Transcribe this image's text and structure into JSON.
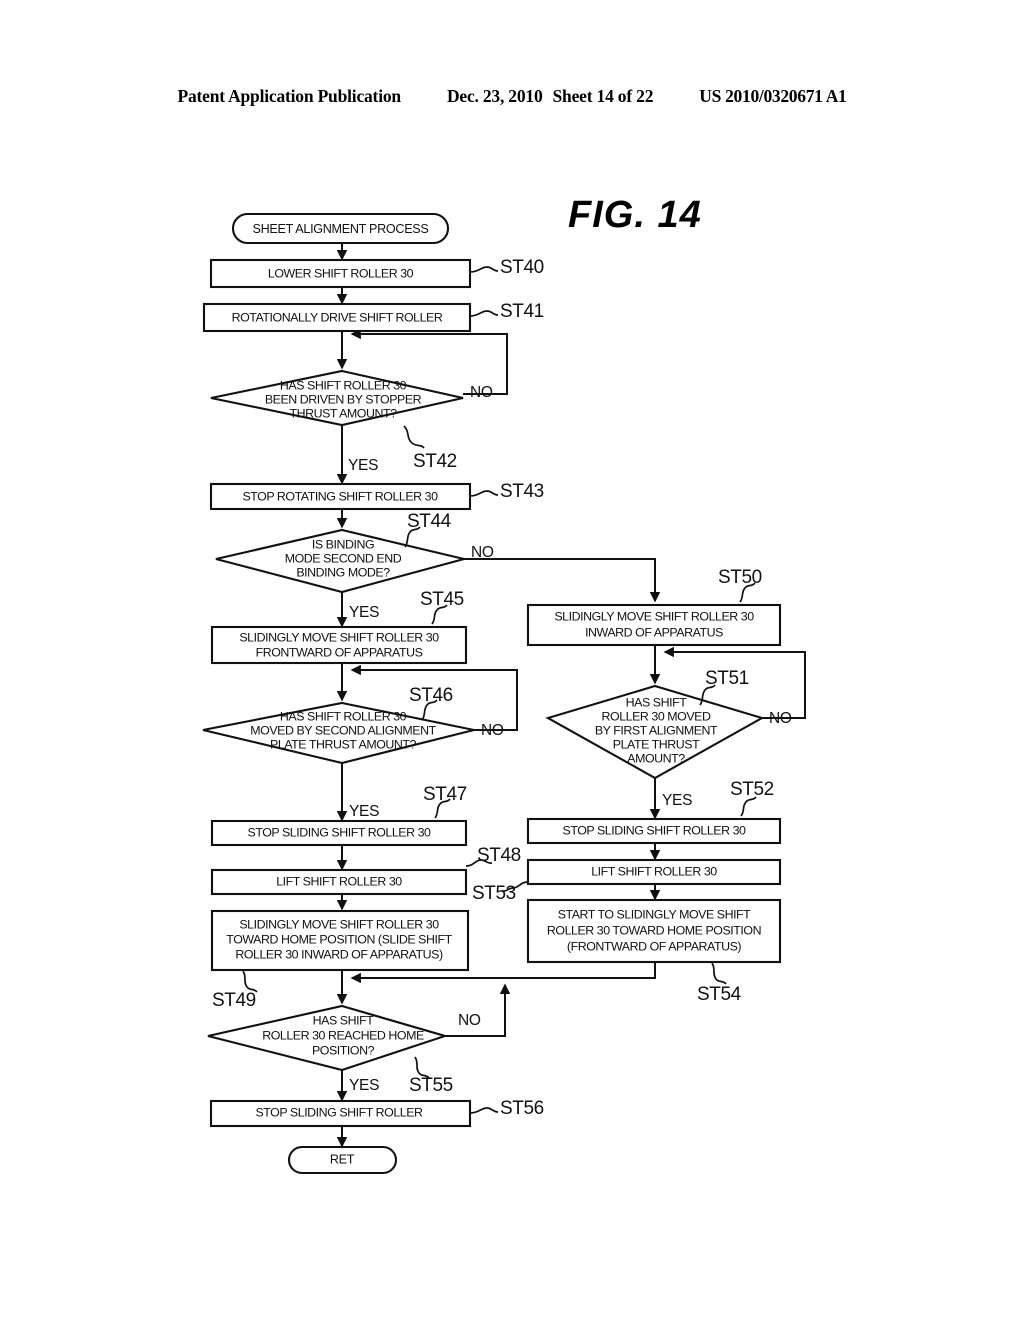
{
  "header": {
    "publication": "Patent Application Publication",
    "date": "Dec. 23, 2010",
    "sheet": "Sheet 14 of 22",
    "patent_number": "US 2010/0320671 A1"
  },
  "figure": {
    "title": "FIG.  14"
  },
  "branch_labels": {
    "yes": "YES",
    "no": "NO"
  },
  "nodes": {
    "start": {
      "label": "SHEET ALIGNMENT PROCESS",
      "shape": "terminator"
    },
    "st40": {
      "step": "ST40",
      "shape": "process",
      "lines": [
        "LOWER SHIFT ROLLER 30"
      ]
    },
    "st41": {
      "step": "ST41",
      "shape": "process",
      "lines": [
        "ROTATIONALLY DRIVE SHIFT ROLLER"
      ]
    },
    "st42": {
      "step": "ST42",
      "shape": "decision",
      "lines": [
        "HAS SHIFT ROLLER 30",
        "BEEN DRIVEN BY STOPPER",
        "THRUST AMOUNT?"
      ]
    },
    "st43": {
      "step": "ST43",
      "shape": "process",
      "lines": [
        "STOP ROTATING SHIFT ROLLER 30"
      ]
    },
    "st44": {
      "step": "ST44",
      "shape": "decision",
      "lines": [
        "IS BINDING",
        "MODE SECOND END",
        "BINDING MODE?"
      ]
    },
    "st45": {
      "step": "ST45",
      "shape": "process",
      "lines": [
        "SLIDINGLY MOVE SHIFT ROLLER 30",
        "FRONTWARD OF APPARATUS"
      ]
    },
    "st46": {
      "step": "ST46",
      "shape": "decision",
      "lines": [
        "HAS SHIFT ROLLER 30",
        "MOVED BY SECOND ALIGNMENT",
        "PLATE THRUST AMOUNT?"
      ]
    },
    "st47": {
      "step": "ST47",
      "shape": "process",
      "lines": [
        "STOP SLIDING SHIFT ROLLER 30"
      ]
    },
    "st48": {
      "step": "ST48",
      "shape": "process",
      "lines": [
        "LIFT SHIFT ROLLER 30"
      ]
    },
    "st49": {
      "step": "ST49",
      "shape": "process",
      "lines": [
        "SLIDINGLY MOVE SHIFT ROLLER 30",
        "TOWARD HOME POSITION (SLIDE SHIFT",
        "ROLLER 30 INWARD OF APPARATUS)"
      ]
    },
    "st50": {
      "step": "ST50",
      "shape": "process",
      "lines": [
        "SLIDINGLY MOVE SHIFT ROLLER 30",
        "INWARD OF APPARATUS"
      ]
    },
    "st51": {
      "step": "ST51",
      "shape": "decision",
      "lines": [
        "HAS SHIFT",
        "ROLLER 30 MOVED",
        "BY FIRST ALIGNMENT",
        "PLATE THRUST",
        "AMOUNT?"
      ]
    },
    "st52": {
      "step": "ST52",
      "shape": "process",
      "lines": [
        "STOP SLIDING SHIFT ROLLER 30"
      ]
    },
    "st53": {
      "step": "ST53",
      "shape": "process",
      "lines": [
        "LIFT SHIFT ROLLER 30"
      ]
    },
    "st54": {
      "step": "ST54",
      "shape": "process",
      "lines": [
        "START TO SLIDINGLY MOVE SHIFT",
        "ROLLER 30 TOWARD HOME POSITION",
        "(FRONTWARD OF APPARATUS)"
      ]
    },
    "st55": {
      "step": "ST55",
      "shape": "decision",
      "lines": [
        "HAS SHIFT",
        "ROLLER 30 REACHED HOME",
        "POSITION?"
      ]
    },
    "st56": {
      "step": "ST56",
      "shape": "process",
      "lines": [
        "STOP SLIDING SHIFT ROLLER"
      ]
    },
    "ret": {
      "label": "RET",
      "shape": "terminator"
    }
  }
}
